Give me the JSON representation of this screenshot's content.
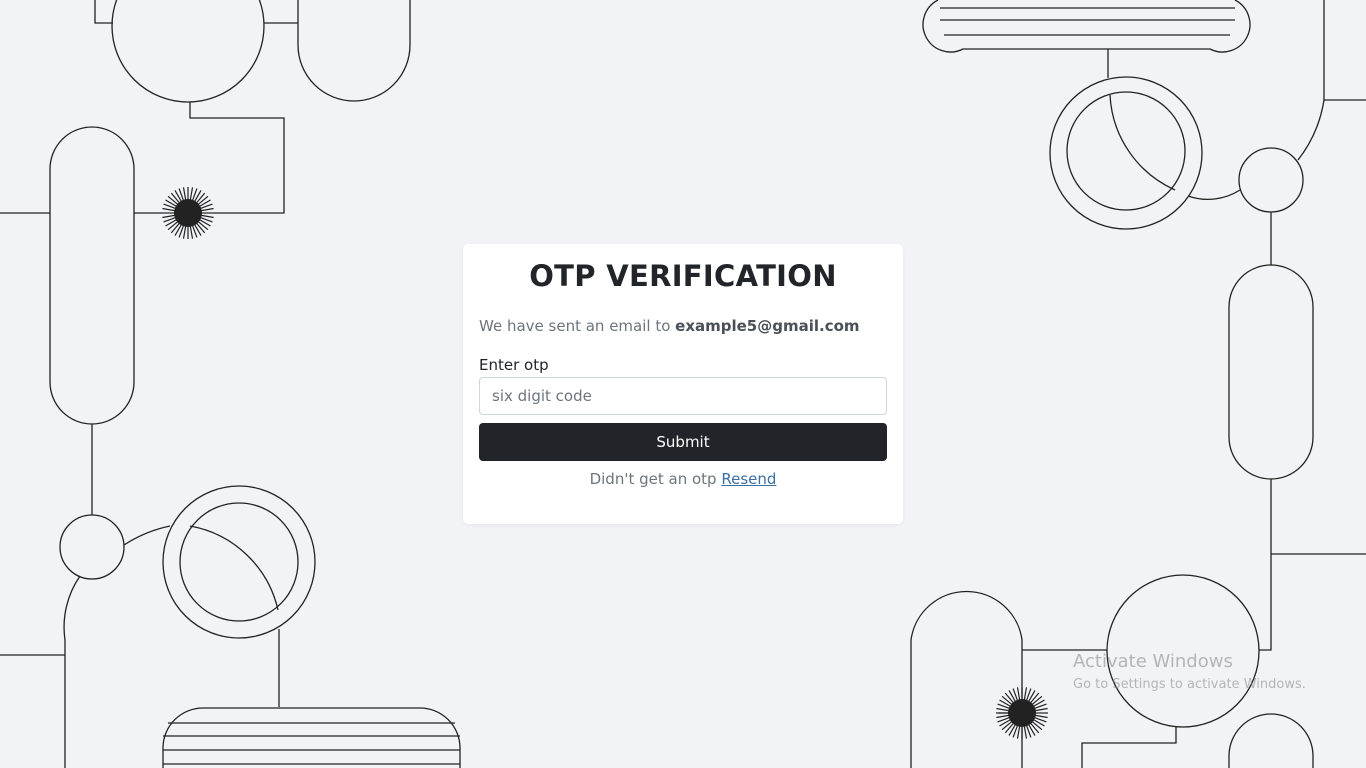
{
  "card": {
    "title": "OTP VERIFICATION",
    "sent_text": "We have sent an email to ",
    "email": "example5@gmail.com",
    "otp_label": "Enter otp",
    "otp_value": "",
    "otp_placeholder": "six digit code",
    "submit_label": "Submit",
    "resend_prompt": "Didn't get an otp",
    "resend_label": "Resend"
  },
  "watermark": {
    "title": "Activate Windows",
    "subtitle": "Go to Settings to activate Windows."
  },
  "colors": {
    "background": "#f2f3f7",
    "card": "#ffffff",
    "button": "#212529",
    "link": "#3a6fa5"
  }
}
